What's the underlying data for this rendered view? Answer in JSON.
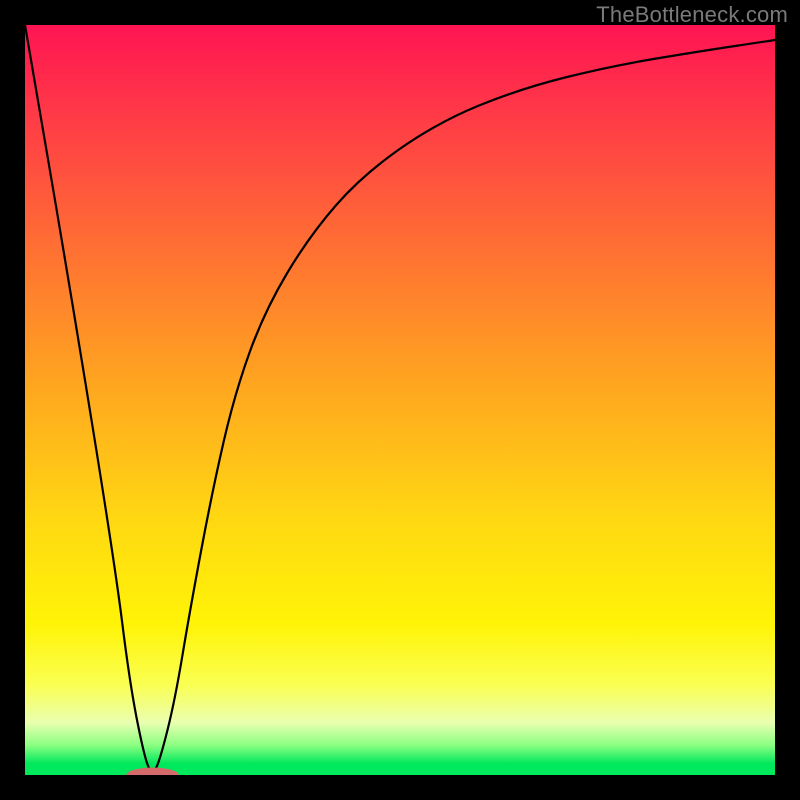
{
  "watermark": {
    "text": "TheBottleneck.com"
  },
  "chart_data": {
    "type": "line",
    "title": "",
    "xlabel": "",
    "ylabel": "",
    "xlim": [
      0,
      100
    ],
    "ylim": [
      0,
      100
    ],
    "grid": false,
    "legend": false,
    "series": [
      {
        "name": "bottleneck-curve",
        "x": [
          0,
          6,
          12,
          14,
          16,
          17,
          18,
          20,
          22,
          25,
          28,
          32,
          38,
          45,
          55,
          66,
          78,
          90,
          100
        ],
        "values": [
          100,
          65,
          28,
          12,
          2,
          0,
          2,
          10,
          22,
          38,
          51,
          62,
          72,
          80,
          87,
          91.5,
          94.5,
          96.5,
          98
        ]
      }
    ],
    "marker": {
      "name": "optimal-point",
      "x": 17,
      "y": 0,
      "rx": 3.5,
      "ry": 1.0,
      "color": "#d46a6a"
    },
    "background_gradient": {
      "orientation": "vertical",
      "stops": [
        {
          "pos": 0,
          "color": "#ff1452"
        },
        {
          "pos": 0.12,
          "color": "#ff3a47"
        },
        {
          "pos": 0.28,
          "color": "#ff6a35"
        },
        {
          "pos": 0.48,
          "color": "#ffa61f"
        },
        {
          "pos": 0.66,
          "color": "#ffd812"
        },
        {
          "pos": 0.8,
          "color": "#fff407"
        },
        {
          "pos": 0.88,
          "color": "#faff53"
        },
        {
          "pos": 0.93,
          "color": "#eaffb0"
        },
        {
          "pos": 0.96,
          "color": "#8cff82"
        },
        {
          "pos": 0.985,
          "color": "#00e85c"
        },
        {
          "pos": 1.0,
          "color": "#00e85c"
        }
      ]
    }
  }
}
